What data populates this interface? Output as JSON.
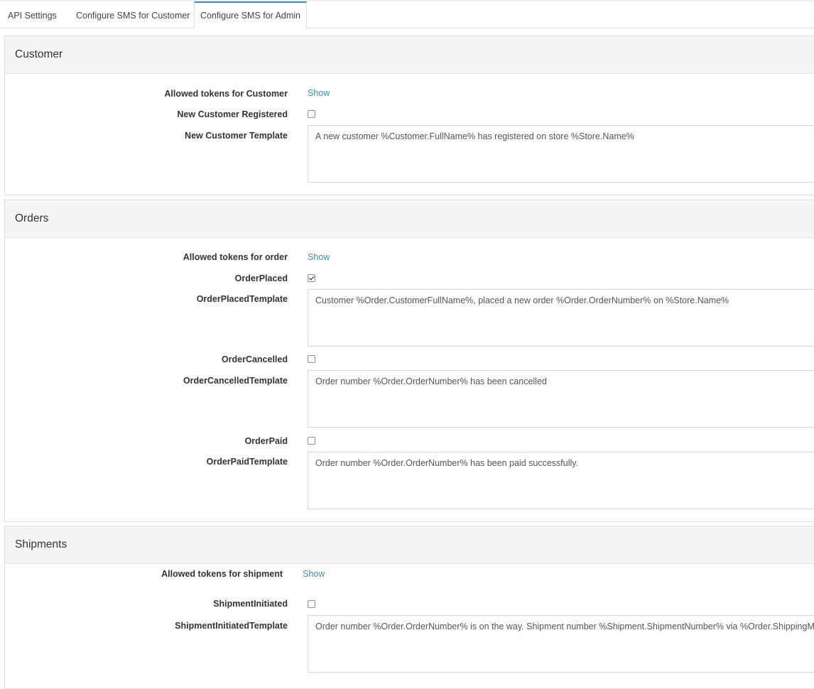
{
  "tabs": [
    {
      "label": "API Settings"
    },
    {
      "label": "Configure SMS for Customer"
    },
    {
      "label": "Configure SMS for Admin"
    }
  ],
  "customer": {
    "title": "Customer",
    "allowed_tokens_label": "Allowed tokens for Customer",
    "show_label": "Show",
    "registered_label": "New Customer Registered",
    "registered_checked": false,
    "template_label": "New Customer Template",
    "template_value": "A new customer %Customer.FullName% has registered on store %Store.Name%"
  },
  "orders": {
    "title": "Orders",
    "allowed_tokens_label": "Allowed tokens for order",
    "show_label": "Show",
    "placed_label": "OrderPlaced",
    "placed_checked": true,
    "placed_template_label": "OrderPlacedTemplate",
    "placed_template_value": "Customer %Order.CustomerFullName%, placed a new order %Order.OrderNumber%  on %Store.Name%",
    "cancelled_label": "OrderCancelled",
    "cancelled_checked": false,
    "cancelled_template_label": "OrderCancelledTemplate",
    "cancelled_template_value": "Order number %Order.OrderNumber% has been cancelled",
    "paid_label": "OrderPaid",
    "paid_checked": false,
    "paid_template_label": "OrderPaidTemplate",
    "paid_template_value": "Order number %Order.OrderNumber% has been paid successfully."
  },
  "shipments": {
    "title": "Shipments",
    "allowed_tokens_label": "Allowed tokens for shipment",
    "show_label": "Show",
    "initiated_label": "ShipmentInitiated",
    "initiated_checked": false,
    "initiated_template_label": "ShipmentInitiatedTemplate",
    "initiated_template_value": "Order number %Order.OrderNumber% is on the way. Shipment number %Shipment.ShipmentNumber% via %Order.ShippingMethod%"
  },
  "colors": {
    "accent": "#3c8dbc",
    "panel_heading_bg": "#f5f5f5",
    "border": "#dddddd"
  },
  "icons": {
    "checkbox_checked": "check-icon"
  }
}
